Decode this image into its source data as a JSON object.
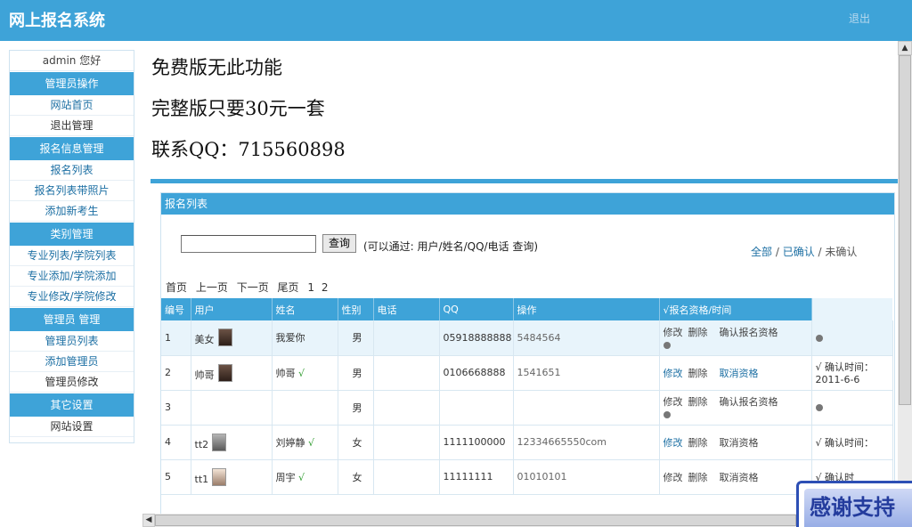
{
  "header": {
    "title": "网上报名系统",
    "logout": "退出"
  },
  "sidebar": {
    "greeting": "admin 您好",
    "sections": [
      {
        "title": "管理员操作",
        "items": [
          "网站首页",
          "退出管理"
        ]
      },
      {
        "title": "报名信息管理",
        "items": [
          "报名列表",
          "报名列表带照片",
          "添加新考生"
        ]
      },
      {
        "title": "类别管理",
        "items": [
          "专业列表/学院列表",
          "专业添加/学院添加",
          "专业修改/学院修改"
        ]
      },
      {
        "title": "管理员 管理",
        "items": [
          "管理员列表",
          "添加管理员",
          "管理员修改"
        ]
      },
      {
        "title": "其它设置",
        "items": [
          "网站设置"
        ]
      }
    ]
  },
  "promo": {
    "line1": "免费版无此功能",
    "line2": "完整版只要30元一套",
    "line3": "联系QQ：715560898"
  },
  "panel": {
    "title": "报名列表",
    "search_button": "查询",
    "search_hint": "(可以通过: 用户/姓名/QQ/电话 查询)",
    "filters": [
      "全部",
      "已确认",
      "未确认"
    ],
    "pager": [
      "首页",
      "上一页",
      "下一页",
      "尾页",
      "1",
      "2"
    ],
    "columns": [
      "编号",
      "用户",
      "姓名",
      "性别",
      "电话",
      "QQ",
      "操作",
      "√报名资格/时间"
    ],
    "rows": [
      {
        "id": "1",
        "user": "美女",
        "name": "我爱你",
        "confirmed_check": "",
        "gender": "男",
        "phone": "",
        "qq": "05918888888",
        "op_text": "5484564",
        "edit": "修改",
        "delete": "删除",
        "action": "确认报名资格",
        "status_mark": "",
        "status_text": ""
      },
      {
        "id": "2",
        "user": "帅哥",
        "name": "帅哥",
        "confirmed_check": "√",
        "gender": "男",
        "phone": "",
        "qq": "0106668888",
        "op_text": "1541651",
        "edit": "修改",
        "delete": "删除",
        "action": "取消资格",
        "status_mark": "√",
        "status_text": "确认时间：2011-6-6"
      },
      {
        "id": "3",
        "user": "",
        "name": "",
        "confirmed_check": "",
        "gender": "男",
        "phone": "",
        "qq": "",
        "op_text": "",
        "edit": "修改",
        "delete": "删除",
        "action": "确认报名资格",
        "status_mark": "",
        "status_text": ""
      },
      {
        "id": "4",
        "user": "tt2",
        "name": "刘婷静",
        "confirmed_check": "√",
        "gender": "女",
        "phone": "",
        "qq": "1111100000",
        "op_text": "12334665550com",
        "edit": "修改",
        "delete": "删除",
        "action": "取消资格",
        "status_mark": "√",
        "status_text": "确认时间："
      },
      {
        "id": "5",
        "user": "tt1",
        "name": "周宇",
        "confirmed_check": "√",
        "gender": "女",
        "phone": "",
        "qq": "11111111",
        "op_text": "01010101",
        "edit": "修改",
        "delete": "删除",
        "action": "取消资格",
        "status_mark": "√",
        "status_text": "确认时"
      }
    ]
  },
  "badge": {
    "text": "感谢支持"
  },
  "colors": {
    "accent": "#3ea3d8",
    "link": "#1c6fa3",
    "badge": "#2d4fb5"
  }
}
